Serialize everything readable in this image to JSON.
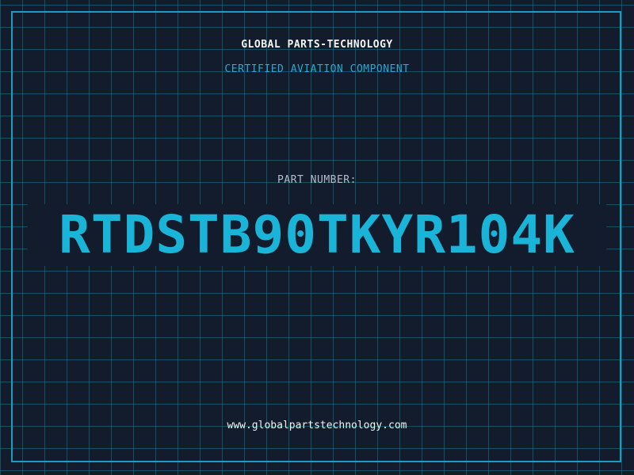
{
  "company": "GLOBAL PARTS-TECHNOLOGY",
  "subtitle": "CERTIFIED AVIATION COMPONENT",
  "part_label": "PART NUMBER:",
  "part_number": "RTDSTB90TKYR104K",
  "website": "www.globalpartstechnology.com",
  "colors": {
    "background": "#131c2c",
    "grid": "#147896",
    "frame": "#1a9ec0",
    "accent": "#1ab4d8",
    "text": "#f2f4f6",
    "muted": "#b3bdc7"
  }
}
